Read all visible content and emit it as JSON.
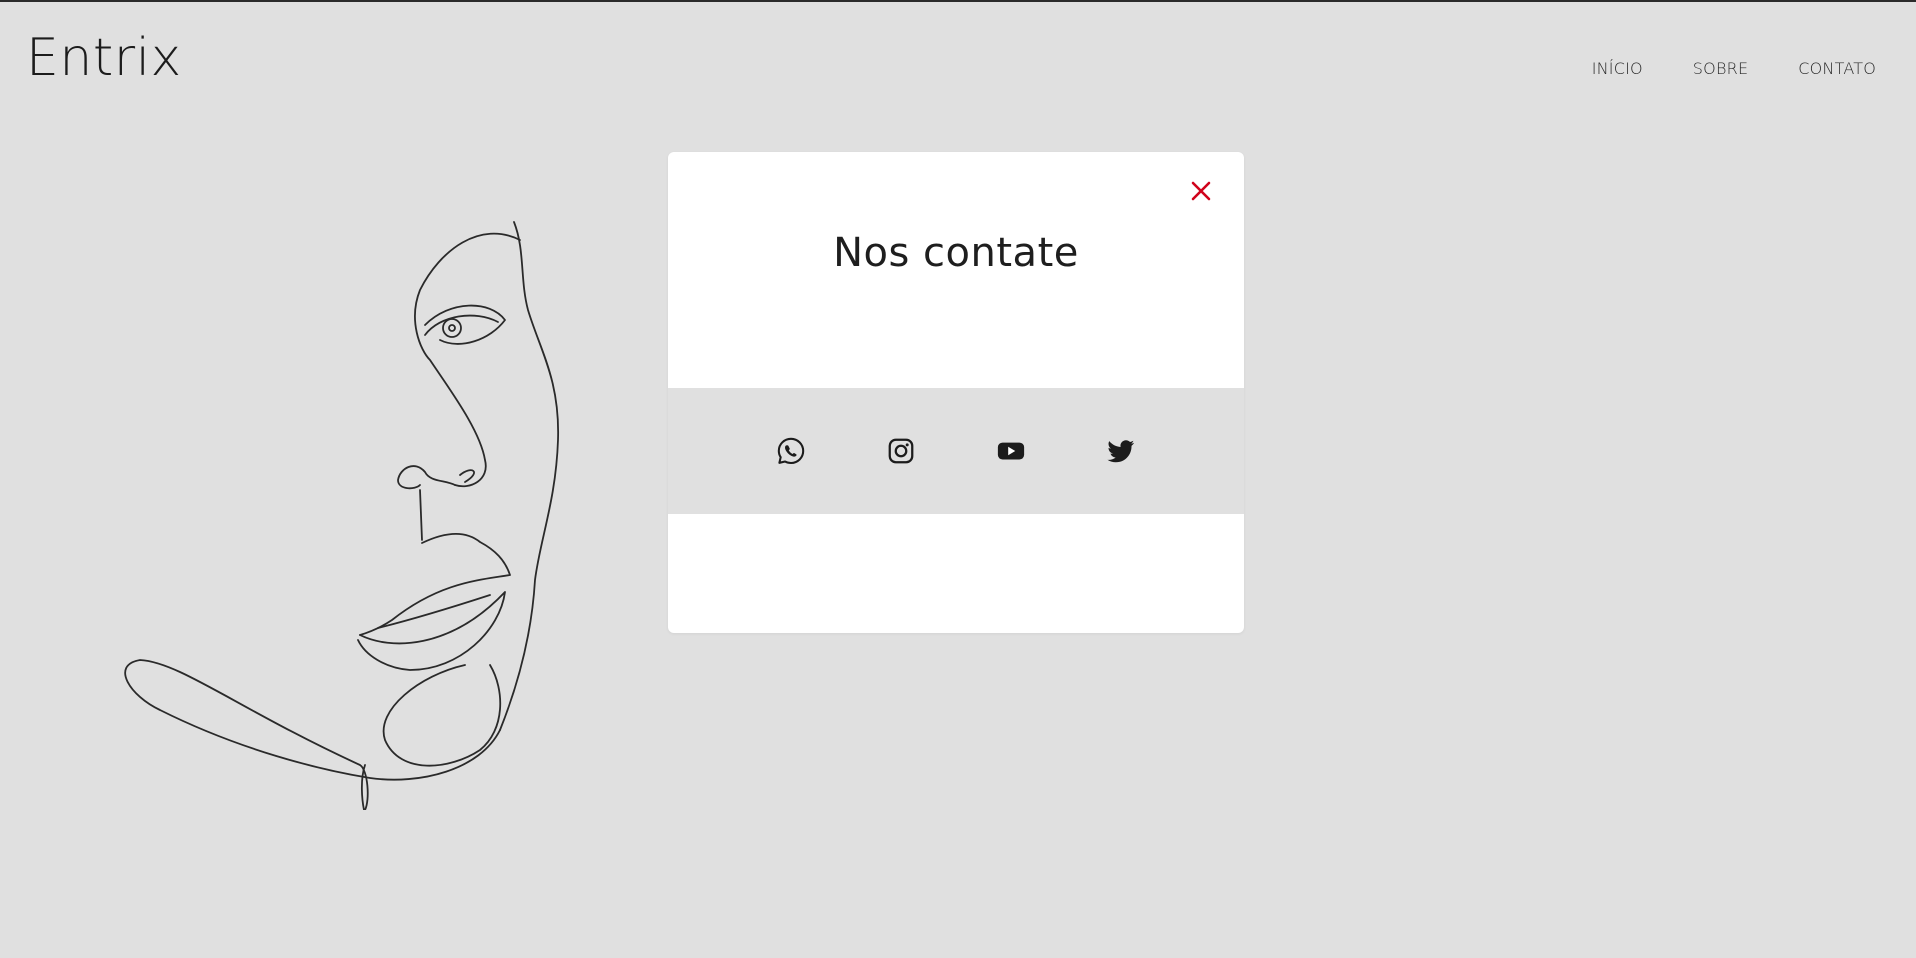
{
  "header": {
    "brand": "Entrix",
    "nav": [
      {
        "label": "INÍCIO"
      },
      {
        "label": "SOBRE"
      },
      {
        "label": "CONTATO"
      }
    ]
  },
  "modal": {
    "title": "Nos contate",
    "close_icon": "close-icon",
    "close_color": "#d0021b",
    "social": [
      {
        "icon": "whatsapp-icon"
      },
      {
        "icon": "instagram-icon"
      },
      {
        "icon": "youtube-icon"
      },
      {
        "icon": "twitter-icon"
      }
    ]
  },
  "colors": {
    "background": "#e0e0e0",
    "modal": "#ffffff",
    "text": "#1e1e1e",
    "accent_close": "#d0021b"
  },
  "decor": {
    "illustration": "face-line-art"
  }
}
